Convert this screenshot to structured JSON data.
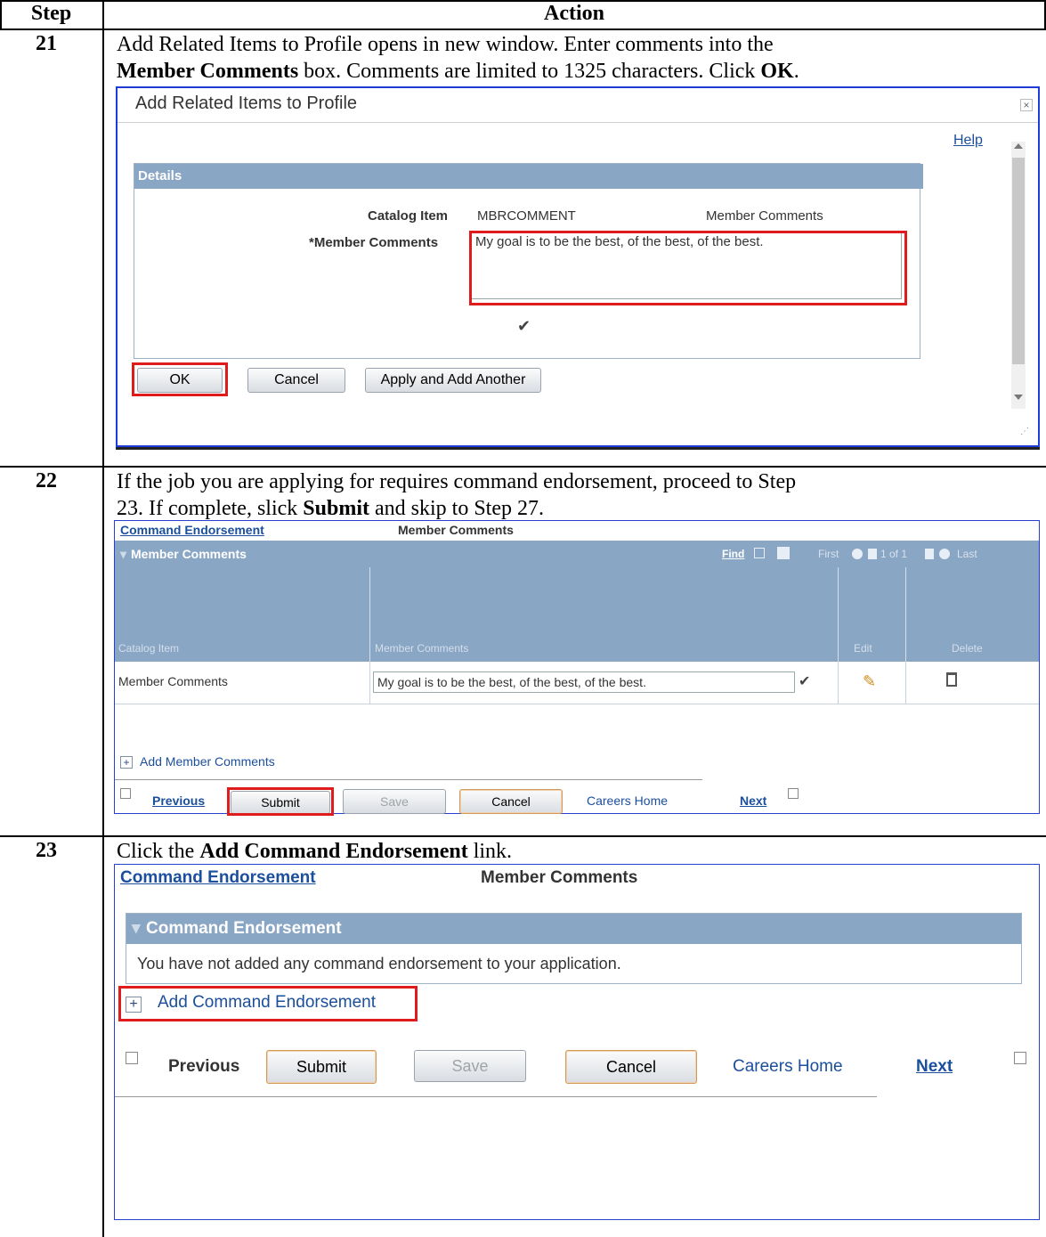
{
  "table": {
    "header_step": "Step",
    "header_action": "Action"
  },
  "step21": {
    "number": "21",
    "line1": "Add Related Items to Profile opens in new window. Enter comments into the",
    "line2_b1": "Member Comments",
    "line2_t1": " box. Comments are limited to 1325 characters. Click ",
    "line2_b2": "OK",
    "line2_t2": ".",
    "dialog": {
      "title": "Add Related Items to Profile",
      "help": "Help",
      "section": "Details",
      "catalog_label": "Catalog Item",
      "catalog_value": "MBRCOMMENT",
      "catalog_desc": "Member Comments",
      "comments_label": "*Member Comments",
      "comments_value": "My goal is to be the best, of the best, of the best.",
      "ok": "OK",
      "cancel": "Cancel",
      "apply": "Apply and Add Another"
    }
  },
  "step22": {
    "number": "22",
    "line1": "If the job you are applying for requires command endorsement, proceed to Step",
    "line2_t1": "23. If complete, slick ",
    "line2_b1": "Submit",
    "line2_t2": " and skip to Step 27.",
    "screen": {
      "tab1": "Command Endorsement",
      "tab2": "Member Comments",
      "grid_title": "Member Comments",
      "find": "Find",
      "nav": "First",
      "count": "1 of 1",
      "last": "Last",
      "columns": [
        "Catalog Item",
        "Member Comments",
        "Edit",
        "Delete"
      ],
      "row_item": "Member Comments",
      "row_comment": "My goal is to be the best, of the best, of the best.",
      "add": "Add Member Comments",
      "previous": "Previous",
      "submit": "Submit",
      "save": "Save",
      "cancel": "Cancel",
      "careers_home": "Careers Home",
      "next": "Next"
    }
  },
  "step23": {
    "number": "23",
    "line1_t1": "Click the ",
    "line1_b1": "Add Command Endorsement",
    "line1_t2": " link.",
    "screen": {
      "tab1": "Command Endorsement",
      "tab2": "Member Comments",
      "section": "Command Endorsement",
      "message": "You have not added any command endorsement to your application.",
      "add": "Add Command Endorsement",
      "previous": "Previous",
      "submit": "Submit",
      "save": "Save",
      "cancel": "Cancel",
      "careers_home": "Careers Home",
      "next": "Next"
    }
  }
}
